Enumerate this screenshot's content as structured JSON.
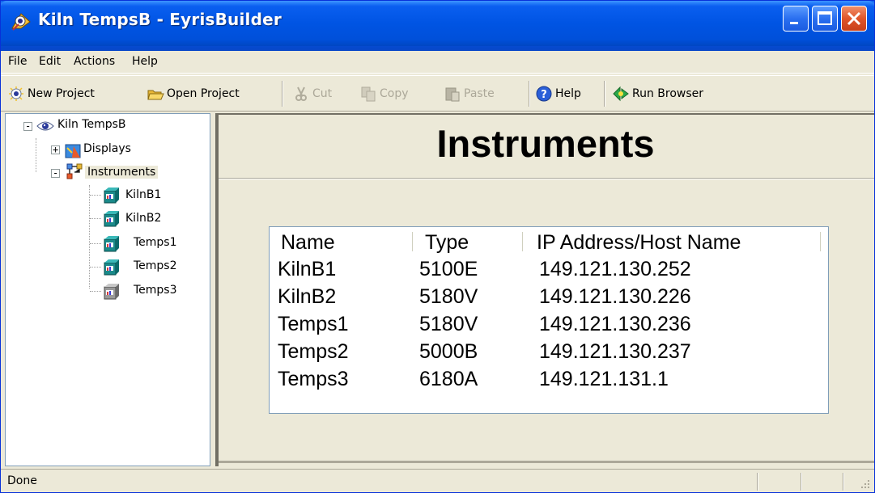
{
  "window": {
    "title": "Kiln TempsB - EyrisBuilder"
  },
  "menu": {
    "items": [
      "File",
      "Edit",
      "Actions",
      "Help"
    ]
  },
  "toolbar": {
    "new_project": "New Project",
    "open_project": "Open Project",
    "cut": "Cut",
    "copy": "Copy",
    "paste": "Paste",
    "help": "Help",
    "run_browser": "Run Browser"
  },
  "tree": {
    "root": "Kiln TempsB",
    "displays": "Displays",
    "instruments": "Instruments",
    "children": [
      "KilnB1",
      "KilnB2",
      "Temps1",
      "Temps2",
      "Temps3"
    ]
  },
  "main": {
    "title": "Instruments",
    "columns": [
      "Name",
      "Type",
      "IP Address/Host Name"
    ],
    "rows": [
      [
        "KilnB1",
        "5100E",
        "149.121.130.252"
      ],
      [
        "KilnB2",
        "5180V",
        "149.121.130.226"
      ],
      [
        "Temps1",
        "5180V",
        "149.121.130.236"
      ],
      [
        "Temps2",
        "5000B",
        "149.121.130.237"
      ],
      [
        "Temps3",
        "6180A",
        "149.121.131.1"
      ]
    ]
  },
  "status": {
    "text": "Done"
  },
  "colors": {
    "title_bar": "#0054E3",
    "window_face": "#ECE9D8",
    "close_button": "#E0552A"
  }
}
